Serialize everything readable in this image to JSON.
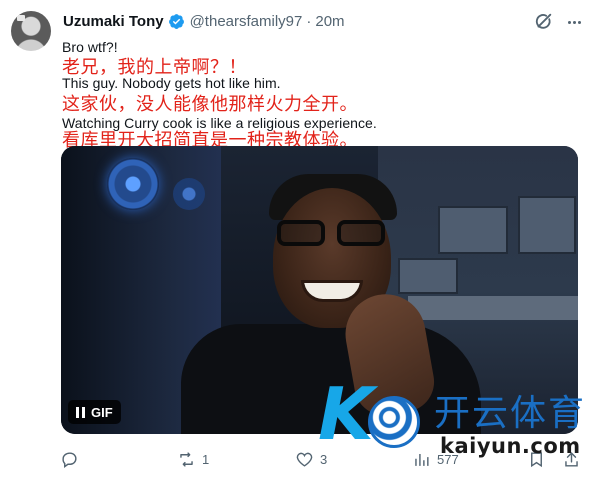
{
  "tweet": {
    "author_name": "Uzumaki Tony",
    "handle": "@thearsfamily97",
    "separator": "·",
    "time": "20m",
    "lines": {
      "l1_en": "Bro wtf?!",
      "l1_zh": "老兄，我的上帝啊？！",
      "l2_en": "This guy. Nobody gets hot like him.",
      "l2_zh": "这家伙，没人能像他那样火力全开。",
      "l3_en": "Watching Curry cook is like a religious experience.",
      "l3_zh": "看库里开大招简直是一种宗教体验。"
    }
  },
  "media": {
    "badge_label": "GIF"
  },
  "actions": {
    "reply_count": "",
    "retweet_count": "1",
    "like_count": "3",
    "view_count": "577"
  },
  "watermark": {
    "brand_cn": "开云体育",
    "url": "kaiyun.com"
  },
  "colors": {
    "translation_red": "#e2231a",
    "verified_blue": "#1d9bf0",
    "secondary_gray": "#536471",
    "watermark_blue": "#1a6fc4"
  }
}
